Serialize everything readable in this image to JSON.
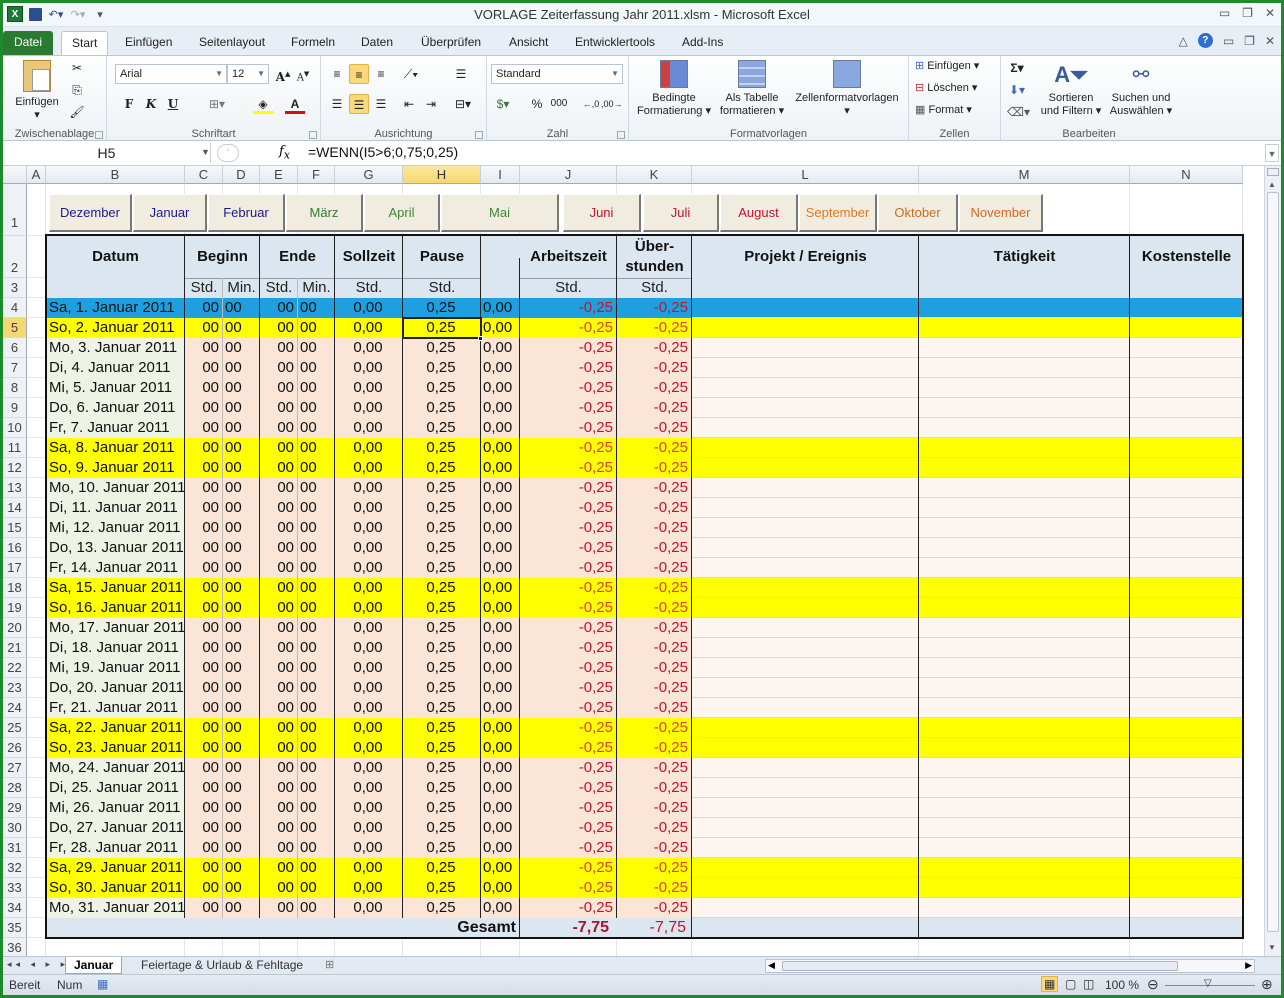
{
  "window": {
    "title": "VORLAGE Zeiterfassung Jahr 2011.xlsm  -  Microsoft Excel"
  },
  "ribbon_tabs": [
    "Datei",
    "Start",
    "Einfügen",
    "Seitenlayout",
    "Formeln",
    "Daten",
    "Überprüfen",
    "Ansicht",
    "Entwicklertools",
    "Add-Ins"
  ],
  "active_tab": "Start",
  "ribbon": {
    "clipboard": {
      "paste": "Einfügen",
      "label": "Zwischenablage"
    },
    "font": {
      "name": "Arial",
      "size": "12",
      "bold": "F",
      "italic": "K",
      "underline": "U",
      "label": "Schriftart"
    },
    "alignment": {
      "label": "Ausrichtung"
    },
    "number": {
      "format": "Standard",
      "percent": "%",
      "thousands": "000",
      "label": "Zahl"
    },
    "styles": {
      "conditional": "Bedingte\nFormatierung",
      "conditional_1": "Bedingte",
      "conditional_2": "Formatierung ▾",
      "table_1": "Als Tabelle",
      "table_2": "formatieren ▾",
      "cellstyles": "Zellenformatvorlagen",
      "label": "Formatvorlagen"
    },
    "cells": {
      "insert": "Einfügen",
      "delete": "Löschen",
      "format": "Format",
      "label": "Zellen"
    },
    "editing": {
      "sort_1": "Sortieren",
      "sort_2": "und Filtern ▾",
      "find_1": "Suchen und",
      "find_2": "Auswählen ▾",
      "label": "Bearbeiten"
    }
  },
  "formula_bar": {
    "name_box": "H5",
    "fx": "fx",
    "formula": "=WENN(I5>6;0,75;0,25)"
  },
  "columns": [
    "A",
    "B",
    "C",
    "D",
    "E",
    "F",
    "G",
    "H",
    "I",
    "J",
    "K",
    "L",
    "M",
    "N"
  ],
  "selected_column": "H",
  "selected_cell": "H5",
  "month_buttons": [
    {
      "label": "Dezember",
      "color": "#1a1a8c"
    },
    {
      "label": "Januar",
      "color": "#1a1a8c"
    },
    {
      "label": "Februar",
      "color": "#1a1a8c"
    },
    {
      "label": "März",
      "color": "#2e7d32"
    },
    {
      "label": "April",
      "color": "#3a8a3a"
    },
    {
      "label": "Mai",
      "color": "#3a8a3a"
    },
    {
      "label": "Juni",
      "color": "#c0152a"
    },
    {
      "label": "Juli",
      "color": "#c0152a"
    },
    {
      "label": "August",
      "color": "#c0152a"
    },
    {
      "label": "September",
      "color": "#e07a20"
    },
    {
      "label": "Oktober",
      "color": "#d2691e"
    },
    {
      "label": "November",
      "color": "#d2691e"
    }
  ],
  "table_header": {
    "datum": "Datum",
    "beginn": "Beginn",
    "ende": "Ende",
    "sollzeit": "Sollzeit",
    "pause": "Pause",
    "arbeitszeit": "Arbeitszeit",
    "ueber_1": "Über-",
    "ueber_2": "stunden",
    "projekt": "Projekt / Ereignis",
    "taetigkeit": "Tätigkeit",
    "kostenstelle": "Kostenstelle",
    "std": "Std.",
    "min": "Min."
  },
  "rows": [
    {
      "date": "Sa, 1. Januar 2011",
      "type": "holiday"
    },
    {
      "date": "So, 2. Januar 2011",
      "type": "weekend"
    },
    {
      "date": "Mo, 3. Januar 2011",
      "type": "weekday"
    },
    {
      "date": "Di, 4. Januar 2011",
      "type": "weekday"
    },
    {
      "date": "Mi, 5. Januar 2011",
      "type": "weekday"
    },
    {
      "date": "Do, 6. Januar 2011",
      "type": "weekday"
    },
    {
      "date": "Fr, 7. Januar 2011",
      "type": "weekday"
    },
    {
      "date": "Sa, 8. Januar 2011",
      "type": "weekend"
    },
    {
      "date": "So, 9. Januar 2011",
      "type": "weekend"
    },
    {
      "date": "Mo, 10. Januar 2011",
      "type": "weekday"
    },
    {
      "date": "Di, 11. Januar 2011",
      "type": "weekday"
    },
    {
      "date": "Mi, 12. Januar 2011",
      "type": "weekday"
    },
    {
      "date": "Do, 13. Januar 2011",
      "type": "weekday"
    },
    {
      "date": "Fr, 14. Januar 2011",
      "type": "weekday"
    },
    {
      "date": "Sa, 15. Januar 2011",
      "type": "weekend"
    },
    {
      "date": "So, 16. Januar 2011",
      "type": "weekend"
    },
    {
      "date": "Mo, 17. Januar 2011",
      "type": "weekday"
    },
    {
      "date": "Di, 18. Januar 2011",
      "type": "weekday"
    },
    {
      "date": "Mi, 19. Januar 2011",
      "type": "weekday"
    },
    {
      "date": "Do, 20. Januar 2011",
      "type": "weekday"
    },
    {
      "date": "Fr, 21. Januar 2011",
      "type": "weekday"
    },
    {
      "date": "Sa, 22. Januar 2011",
      "type": "weekend"
    },
    {
      "date": "So, 23. Januar 2011",
      "type": "weekend"
    },
    {
      "date": "Mo, 24. Januar 2011",
      "type": "weekday"
    },
    {
      "date": "Di, 25. Januar 2011",
      "type": "weekday"
    },
    {
      "date": "Mi, 26. Januar 2011",
      "type": "weekday"
    },
    {
      "date": "Do, 27. Januar 2011",
      "type": "weekday"
    },
    {
      "date": "Fr, 28. Januar 2011",
      "type": "weekday"
    },
    {
      "date": "Sa, 29. Januar 2011",
      "type": "weekend"
    },
    {
      "date": "So, 30. Januar 2011",
      "type": "weekend"
    },
    {
      "date": "Mo, 31. Januar 2011",
      "type": "weekday"
    }
  ],
  "row_values": {
    "beginn_std": "00",
    "beginn_min": "00",
    "ende_std": "00",
    "ende_min": "00",
    "sollzeit": "0,00",
    "pause": "0,25",
    "i": "0,00",
    "arbeitszeit": "-0,25",
    "ueberstunden": "-0,25"
  },
  "total": {
    "label": "Gesamt",
    "arbeitszeit": "-7,75",
    "ueberstunden": "-7,75"
  },
  "sheet_tabs": [
    "Januar",
    "Feiertage & Urlaub & Fehltage"
  ],
  "active_sheet": "Januar",
  "status": {
    "ready": "Bereit",
    "num": "Num",
    "zoom": "100 %"
  },
  "colors": {
    "holiday": "#1ea0e0",
    "weekend": "#ffff00",
    "weekday_date": "#eef3e6",
    "weekday_num": "#fbe5d6",
    "header": "#dce6f1",
    "negative": "#c0152a",
    "excel_green": "#1d8a2c"
  }
}
